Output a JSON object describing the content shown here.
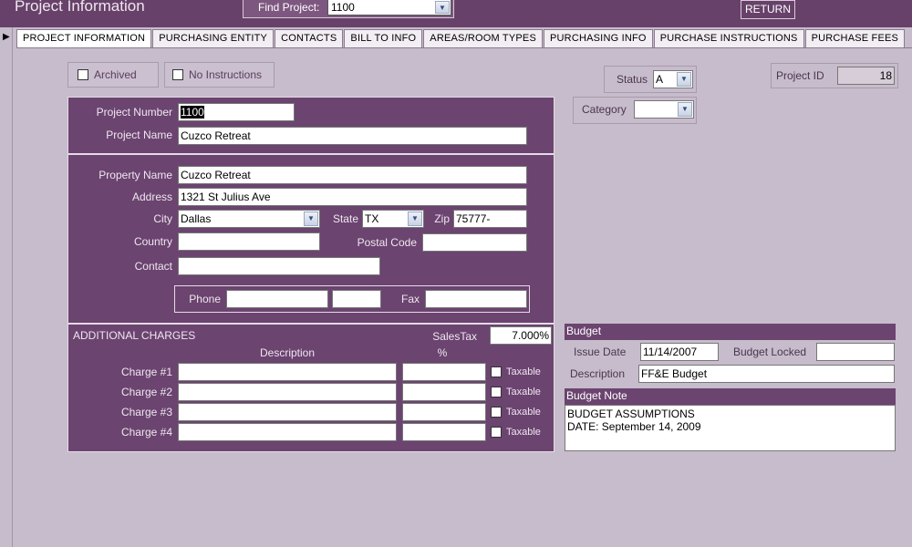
{
  "app": {
    "title": "Project Information"
  },
  "find": {
    "label": "Find Project:",
    "value": "1100"
  },
  "return_label": "RETURN",
  "tabs": [
    "PROJECT INFORMATION",
    "PURCHASING ENTITY",
    "CONTACTS",
    "BILL TO INFO",
    "AREAS/ROOM TYPES",
    "PURCHASING INFO",
    "PURCHASE INSTRUCTIONS",
    "PURCHASE FEES"
  ],
  "flags": {
    "archived_label": "Archived",
    "no_instructions_label": "No Instructions"
  },
  "status": {
    "label": "Status",
    "value": "A"
  },
  "category": {
    "label": "Category",
    "value": ""
  },
  "project_id": {
    "label": "Project ID",
    "value": "18"
  },
  "project": {
    "number_label": "Project  Number",
    "number": "1100",
    "name_label": "Project Name",
    "name": "Cuzco Retreat"
  },
  "property": {
    "name_label": "Property Name",
    "name": "Cuzco Retreat",
    "address_label": "Address",
    "address": "1321 St Julius Ave",
    "city_label": "City",
    "city": "Dallas",
    "state_label": "State",
    "state": "TX",
    "zip_label": "Zip",
    "zip": "75777-",
    "country_label": "Country",
    "country": "",
    "postal_label": "Postal Code",
    "postal": "",
    "contact_label": "Contact",
    "contact": "",
    "phone_label": "Phone",
    "phone": "",
    "phone_ext": "",
    "fax_label": "Fax",
    "fax": ""
  },
  "charges": {
    "title": "ADDITIONAL CHARGES",
    "salestax_label": "SalesTax",
    "salestax": "7.000%",
    "desc_header": "Description",
    "pct_header": "%",
    "taxable_label": "Taxable",
    "rows": [
      "Charge #1",
      "Charge #2",
      "Charge #3",
      "Charge #4"
    ]
  },
  "budget": {
    "header": "Budget",
    "issue_date_label": "Issue Date",
    "issue_date": "11/14/2007",
    "locked_label": "Budget Locked",
    "locked": "",
    "description_label": "Description",
    "description": "FF&E Budget",
    "note_header": "Budget Note",
    "note_line1": "BUDGET ASSUMPTIONS",
    "note_line2": "DATE: September 14, 2009"
  },
  "colors": {
    "accent": "#6b4470",
    "background": "#c7bccb",
    "titlebar": "#67416a"
  },
  "icons": {
    "dropdown": "chevron-down-icon",
    "record": "record-pointer-icon"
  }
}
